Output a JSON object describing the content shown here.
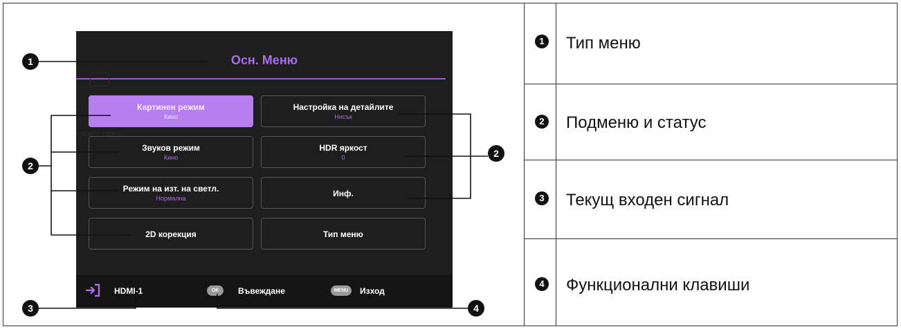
{
  "screen": {
    "title": "Осн. Меню",
    "ghost_text": "ерсетт трасе",
    "tiles": [
      {
        "label": "Картинен режим",
        "value": "Кино"
      },
      {
        "label": "Настройка на детайлите",
        "value": "Нисък"
      },
      {
        "label": "Звуков режим",
        "value": "Кино"
      },
      {
        "label": "HDR яркост",
        "value": "0"
      },
      {
        "label": "Режим на изт. на светл.",
        "value": "Нормална"
      },
      {
        "label": "Инф.",
        "value": ""
      },
      {
        "label": "2D корекция",
        "value": ""
      },
      {
        "label": "Тип меню",
        "value": ""
      }
    ],
    "bottom": {
      "source": "HDMI-1",
      "ok_key": "OK",
      "ok_label": "Въвеждане",
      "menu_key": "MENU",
      "menu_label": "Изход"
    }
  },
  "callouts": [
    "1",
    "2",
    "2",
    "3",
    "4"
  ],
  "legend": [
    {
      "num": "1",
      "text": "Тип меню"
    },
    {
      "num": "2",
      "text": "Подменю и статус"
    },
    {
      "num": "3",
      "text": "Текущ входен сигнал"
    },
    {
      "num": "4",
      "text": "Функционални клавиши"
    }
  ],
  "colors": {
    "accent": "#a86ee8",
    "screen_bg": "#1e1e1e",
    "active_tile": "#b77ef0"
  }
}
